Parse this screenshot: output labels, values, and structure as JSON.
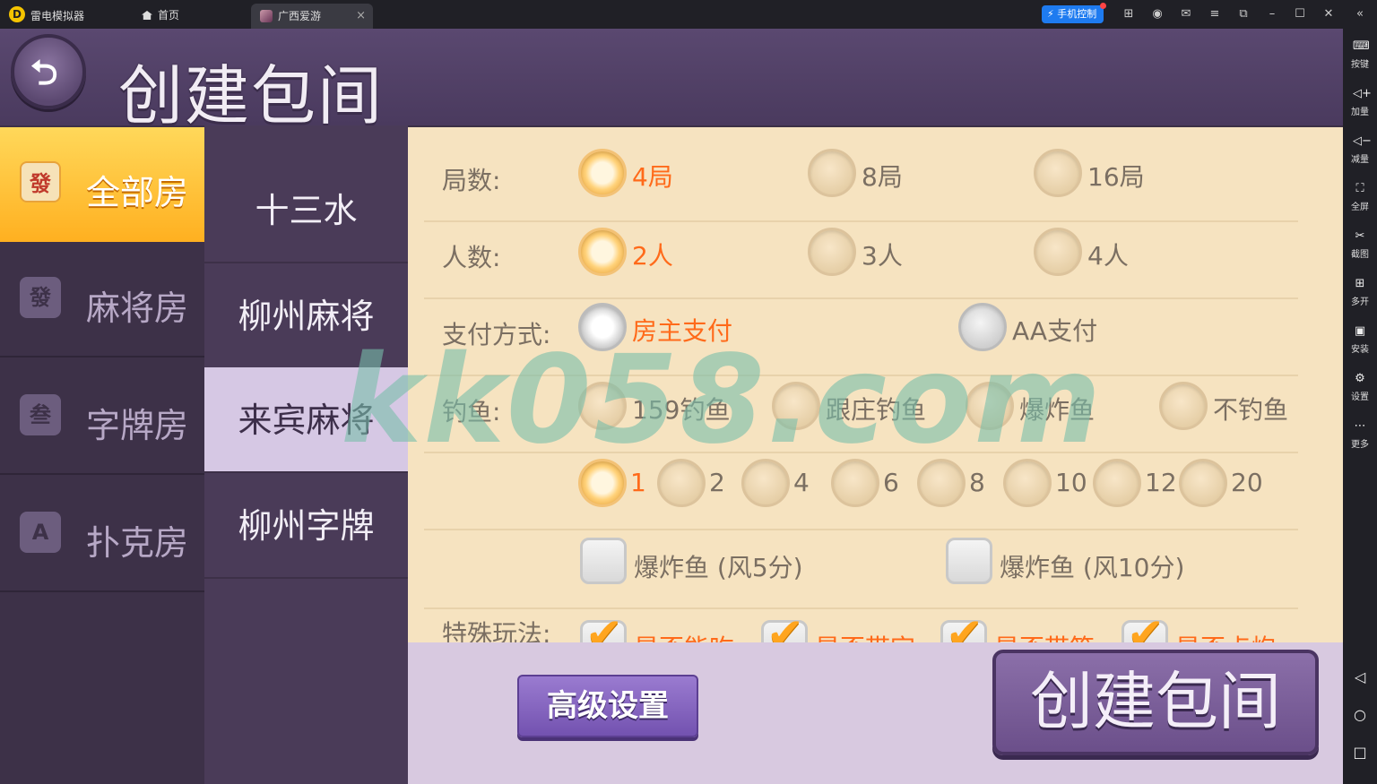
{
  "titlebar": {
    "app_name": "雷电模拟器",
    "home_tab": "首页",
    "active_tab": "广西爱游",
    "close_tab": "×",
    "phone_control": "手机控制",
    "icons": [
      "gamepad-icon",
      "user-icon",
      "mail-icon",
      "menu-icon",
      "restore-icon",
      "minimize-icon",
      "maximize-icon",
      "close-icon",
      "collapse-icon"
    ]
  },
  "toolbar": {
    "items": [
      "按键",
      "加量",
      "减量",
      "全屏",
      "截图",
      "多开",
      "安装",
      "设置",
      "更多"
    ]
  },
  "header": {
    "title": "创建包间"
  },
  "categories": [
    {
      "label": "全部房",
      "icon": "發",
      "active": true
    },
    {
      "label": "麻将房",
      "icon": "發",
      "active": false
    },
    {
      "label": "字牌房",
      "icon": "叁",
      "active": false
    },
    {
      "label": "扑克房",
      "icon": "A",
      "active": false
    }
  ],
  "games": [
    {
      "label": "十三水",
      "selected": false
    },
    {
      "label": "柳州麻将",
      "selected": false
    },
    {
      "label": "来宾麻将",
      "selected": true
    },
    {
      "label": "柳州字牌",
      "selected": false
    }
  ],
  "options": {
    "rounds": {
      "label": "局数:",
      "choices": [
        "4局",
        "8局",
        "16局"
      ],
      "selected": "4局"
    },
    "players": {
      "label": "人数:",
      "choices": [
        "2人",
        "3人",
        "4人"
      ],
      "selected": "2人"
    },
    "payment": {
      "label": "支付方式:",
      "choices": [
        "房主支付",
        "AA支付"
      ],
      "selected": "房主支付"
    },
    "fishing": {
      "label": "钓鱼:",
      "choices": [
        "159钓鱼",
        "跟庄钓鱼",
        "爆炸鱼",
        "不钓鱼"
      ]
    },
    "fish_count": {
      "choices": [
        "1",
        "2",
        "4",
        "6",
        "8",
        "10",
        "12",
        "20"
      ],
      "selected": "1"
    },
    "bomb_fish": {
      "choices": [
        "爆炸鱼 (风5分)",
        "爆炸鱼 (风10分)"
      ]
    },
    "special": {
      "label": "特殊玩法:",
      "choices": [
        "是否能吃",
        "是否带字",
        "是否带筒",
        "是否点炮"
      ],
      "checked": [
        "是否能吃",
        "是否带字",
        "是否带筒",
        "是否点炮"
      ]
    }
  },
  "buttons": {
    "advanced": "高级设置",
    "create": "创建包间"
  },
  "watermark": "kk058.com",
  "colors": {
    "accent": "#ff6a1a",
    "panel": "#f6e3c0",
    "active_category": "#ffc53a",
    "checkmark": "#ffa51f"
  }
}
